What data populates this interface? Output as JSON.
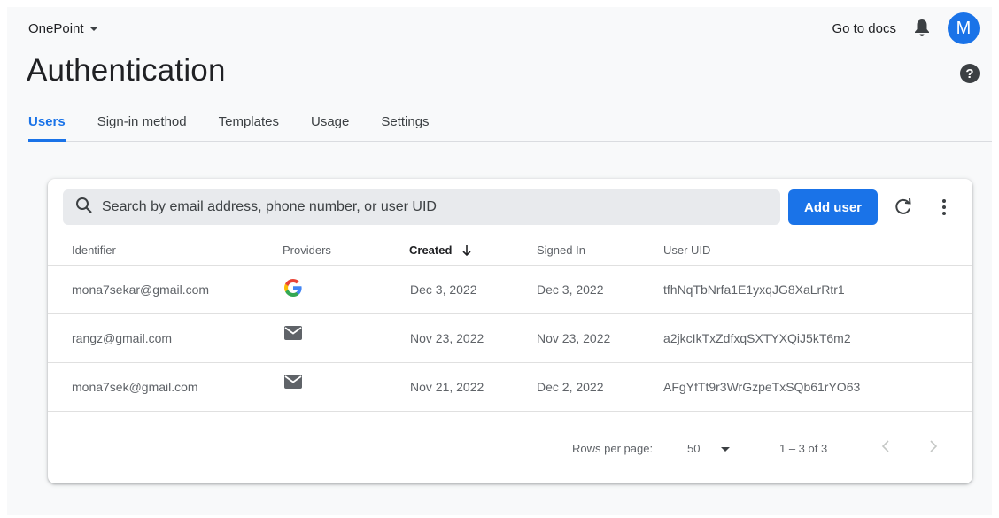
{
  "header": {
    "project_name": "OnePoint",
    "docs_link": "Go to docs",
    "avatar_initial": "M",
    "page_title": "Authentication"
  },
  "tabs": [
    {
      "label": "Users",
      "active": true
    },
    {
      "label": "Sign-in method",
      "active": false
    },
    {
      "label": "Templates",
      "active": false
    },
    {
      "label": "Usage",
      "active": false
    },
    {
      "label": "Settings",
      "active": false
    }
  ],
  "toolbar": {
    "search_placeholder": "Search by email address, phone number, or user UID",
    "add_user_label": "Add user"
  },
  "table": {
    "columns": [
      "Identifier",
      "Providers",
      "Created",
      "Signed In",
      "User UID"
    ],
    "sorted_column": "Created",
    "rows": [
      {
        "identifier": "mona7sekar@gmail.com",
        "provider": "google-icon",
        "created": "Dec 3, 2022",
        "signed_in": "Dec 3, 2022",
        "uid": "tfhNqTbNrfa1E1yxqJG8XaLrRtr1"
      },
      {
        "identifier": "rangz@gmail.com",
        "provider": "email-icon",
        "created": "Nov 23, 2022",
        "signed_in": "Nov 23, 2022",
        "uid": "a2jkcIkTxZdfxqSXTYXQiJ5kT6m2"
      },
      {
        "identifier": "mona7sek@gmail.com",
        "provider": "email-icon",
        "created": "Nov 21, 2022",
        "signed_in": "Dec 2, 2022",
        "uid": "AFgYfTt9r3WrGzpeTxSQb61rYO63"
      }
    ]
  },
  "pagination": {
    "rows_per_page_label": "Rows per page:",
    "rows_per_page_value": "50",
    "range_label": "1 – 3 of 3"
  },
  "colors": {
    "accent": "#1a73e8",
    "background": "#f8f9fa"
  }
}
